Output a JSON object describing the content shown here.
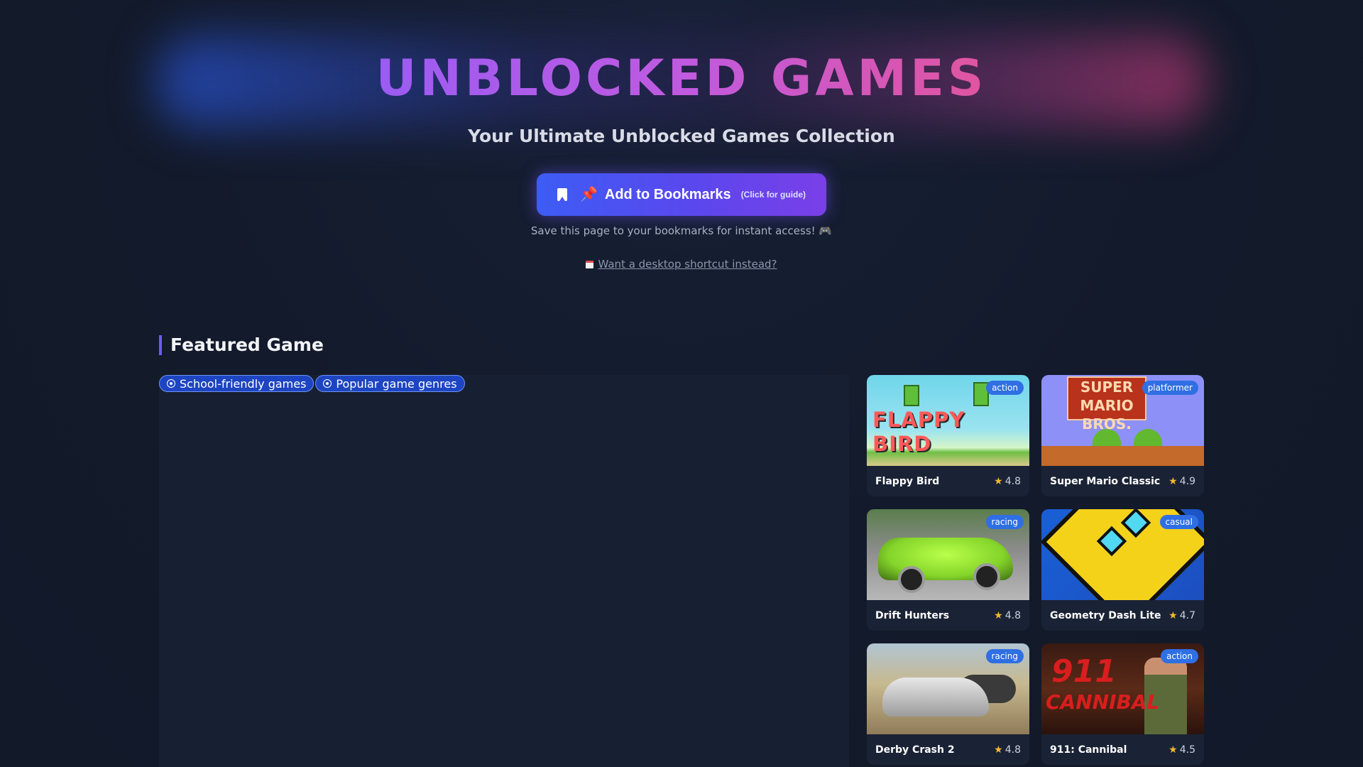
{
  "header": {
    "title": "UNBLOCKED GAMES",
    "subtitle": "Your Ultimate Unblocked Games Collection",
    "bookmark_button": {
      "label": "Add to Bookmarks",
      "hint": "(Click for guide)"
    },
    "save_note": "Save this page to your bookmarks for instant access! 🎮",
    "shortcut_link": "Want a desktop shortcut instead?"
  },
  "featured": {
    "section_title": "Featured Game",
    "tags": [
      {
        "label": "School-friendly games"
      },
      {
        "label": "Popular game genres"
      }
    ]
  },
  "games": [
    {
      "name": "Flappy Bird",
      "genre": "action",
      "rating": "4.8",
      "thumb_text": "FLAPPY BIRD"
    },
    {
      "name": "Super Mario Classic",
      "genre": "platformer",
      "rating": "4.9",
      "thumb_text": "SUPER MARIO BROS."
    },
    {
      "name": "Drift Hunters",
      "genre": "racing",
      "rating": "4.8"
    },
    {
      "name": "Geometry Dash Lite",
      "genre": "casual",
      "rating": "4.7"
    },
    {
      "name": "Derby Crash 2",
      "genre": "racing",
      "rating": "4.8"
    },
    {
      "name": "911: Cannibal",
      "genre": "action",
      "rating": "4.5",
      "thumb_text_1": "911",
      "thumb_text_2": "CANNIBAL"
    }
  ],
  "colors": {
    "background": "#131a2b",
    "title_gradient_start": "#9a5cf2",
    "title_gradient_end": "#e0559f",
    "button_gradient_start": "#3d5cf4",
    "button_gradient_end": "#7a3fe8",
    "badge": "#2f6fe3",
    "star": "#f5b82e",
    "tag": "#1d45c2"
  },
  "icons": {
    "bookmark_button": [
      "bookmark-icon",
      "pushpin-icon"
    ],
    "shortcut_link": "calendar-icon",
    "tags": "target-icon",
    "rating": "star-icon"
  }
}
